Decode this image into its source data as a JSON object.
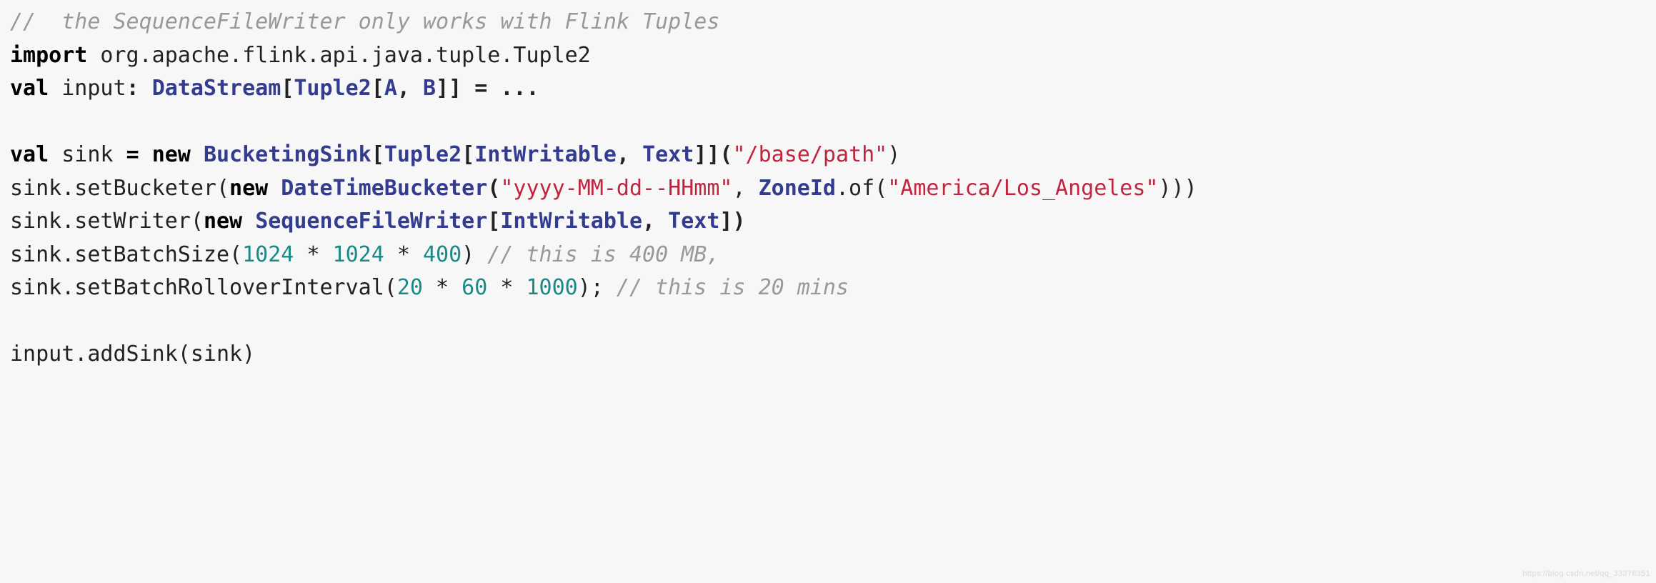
{
  "code": {
    "t01": "//  the SequenceFileWriter only works with Flink Tuples",
    "t02": "import",
    "t03": " org.apache.flink.api.java.tuple.Tuple2",
    "t04": "val",
    "t05": " input",
    "t06": ": ",
    "t07": "DataStream",
    "t08": "[",
    "t09": "Tuple2",
    "t10": "[",
    "t11": "A",
    "t12": ", ",
    "t13": "B",
    "t14": "]] = ...",
    "t15": "val",
    "t16": " sink ",
    "t17": "=",
    "t18": " ",
    "t19": "new",
    "t20": " ",
    "t21": "BucketingSink",
    "t22": "[",
    "t23": "Tuple2",
    "t24": "[",
    "t25": "IntWritable",
    "t26": ", ",
    "t27": "Text",
    "t28": "]](",
    "t29": "\"/base/path\"",
    "t30": ")",
    "t31": "sink.setBucketer(",
    "t32": "new",
    "t33": " ",
    "t34": "DateTimeBucketer",
    "t35": "(",
    "t36": "\"yyyy-MM-dd--HHmm\"",
    "t37": ", ",
    "t38": "ZoneId",
    "t39": ".of(",
    "t40": "\"America/Los_Angeles\"",
    "t41": ")))",
    "t42": "sink.setWriter(",
    "t43": "new",
    "t44": " ",
    "t45": "SequenceFileWriter",
    "t46": "[",
    "t47": "IntWritable",
    "t48": ", ",
    "t49": "Text",
    "t50": "])",
    "t51": "sink.setBatchSize(",
    "t52": "1024",
    "t53": " * ",
    "t54": "1024",
    "t55": " * ",
    "t56": "400",
    "t57": ") ",
    "t58": "// this is 400 MB,",
    "t59": "sink.setBatchRolloverInterval(",
    "t60": "20",
    "t61": " * ",
    "t62": "60",
    "t63": " * ",
    "t64": "1000",
    "t65": "); ",
    "t66": "// this is 20 mins",
    "t67": "input.addSink(sink)"
  },
  "watermark": "https://blog.csdn.net/qq_33376351"
}
